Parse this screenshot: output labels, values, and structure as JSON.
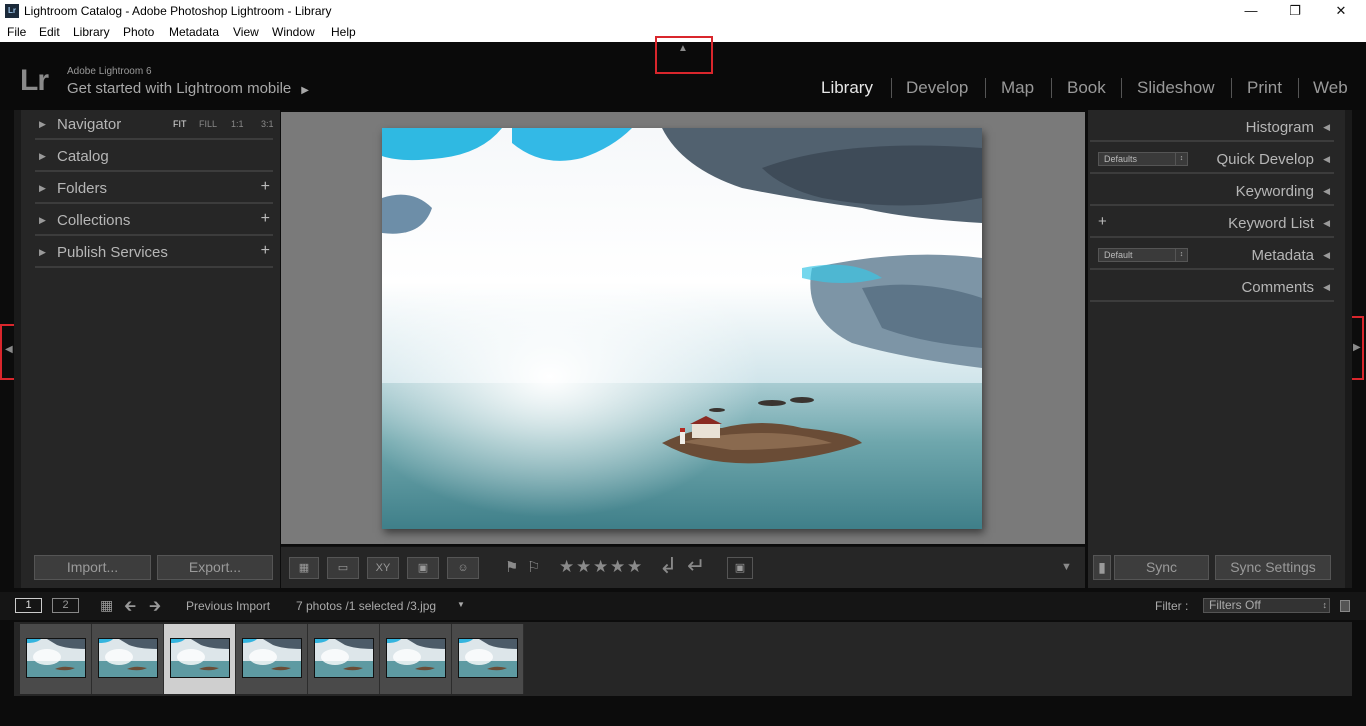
{
  "window": {
    "title": "Lightroom Catalog - Adobe Photoshop Lightroom - Library",
    "badge": "Lr"
  },
  "menu": [
    "File",
    "Edit",
    "Library",
    "Photo",
    "Metadata",
    "View",
    "Window",
    "Help"
  ],
  "identity": {
    "logo": "Lr",
    "product": "Adobe Lightroom 6",
    "mobile_prompt": "Get started with Lightroom mobile"
  },
  "modules": [
    "Library",
    "Develop",
    "Map",
    "Book",
    "Slideshow",
    "Print",
    "Web"
  ],
  "active_module": "Library",
  "left_panel": {
    "navigator": {
      "label": "Navigator",
      "zoom": [
        "FIT",
        "FILL",
        "1:1",
        "3:1"
      ],
      "zoom_selected": "FIT"
    },
    "sections": [
      "Catalog",
      "Folders",
      "Collections",
      "Publish Services"
    ],
    "import_label": "Import...",
    "export_label": "Export..."
  },
  "right_panel": {
    "sections": [
      "Histogram",
      "Quick Develop",
      "Keywording",
      "Keyword List",
      "Metadata",
      "Comments"
    ],
    "quick_develop_preset": "Defaults",
    "metadata_preset": "Default",
    "sync_label": "Sync",
    "sync_settings_label": "Sync Settings"
  },
  "filmstrip_bar": {
    "page1": "1",
    "page2": "2",
    "source": "Previous Import",
    "count": "7 photos /1 selected /3.jpg",
    "filter_label": "Filter :",
    "filter_value": "Filters Off"
  },
  "filmstrip": {
    "count": 7,
    "selected_index": 2
  },
  "colors": {
    "accent_box": "#d9262c",
    "panel_bg": "#262626",
    "canvas_bg": "#7a7a7a"
  }
}
